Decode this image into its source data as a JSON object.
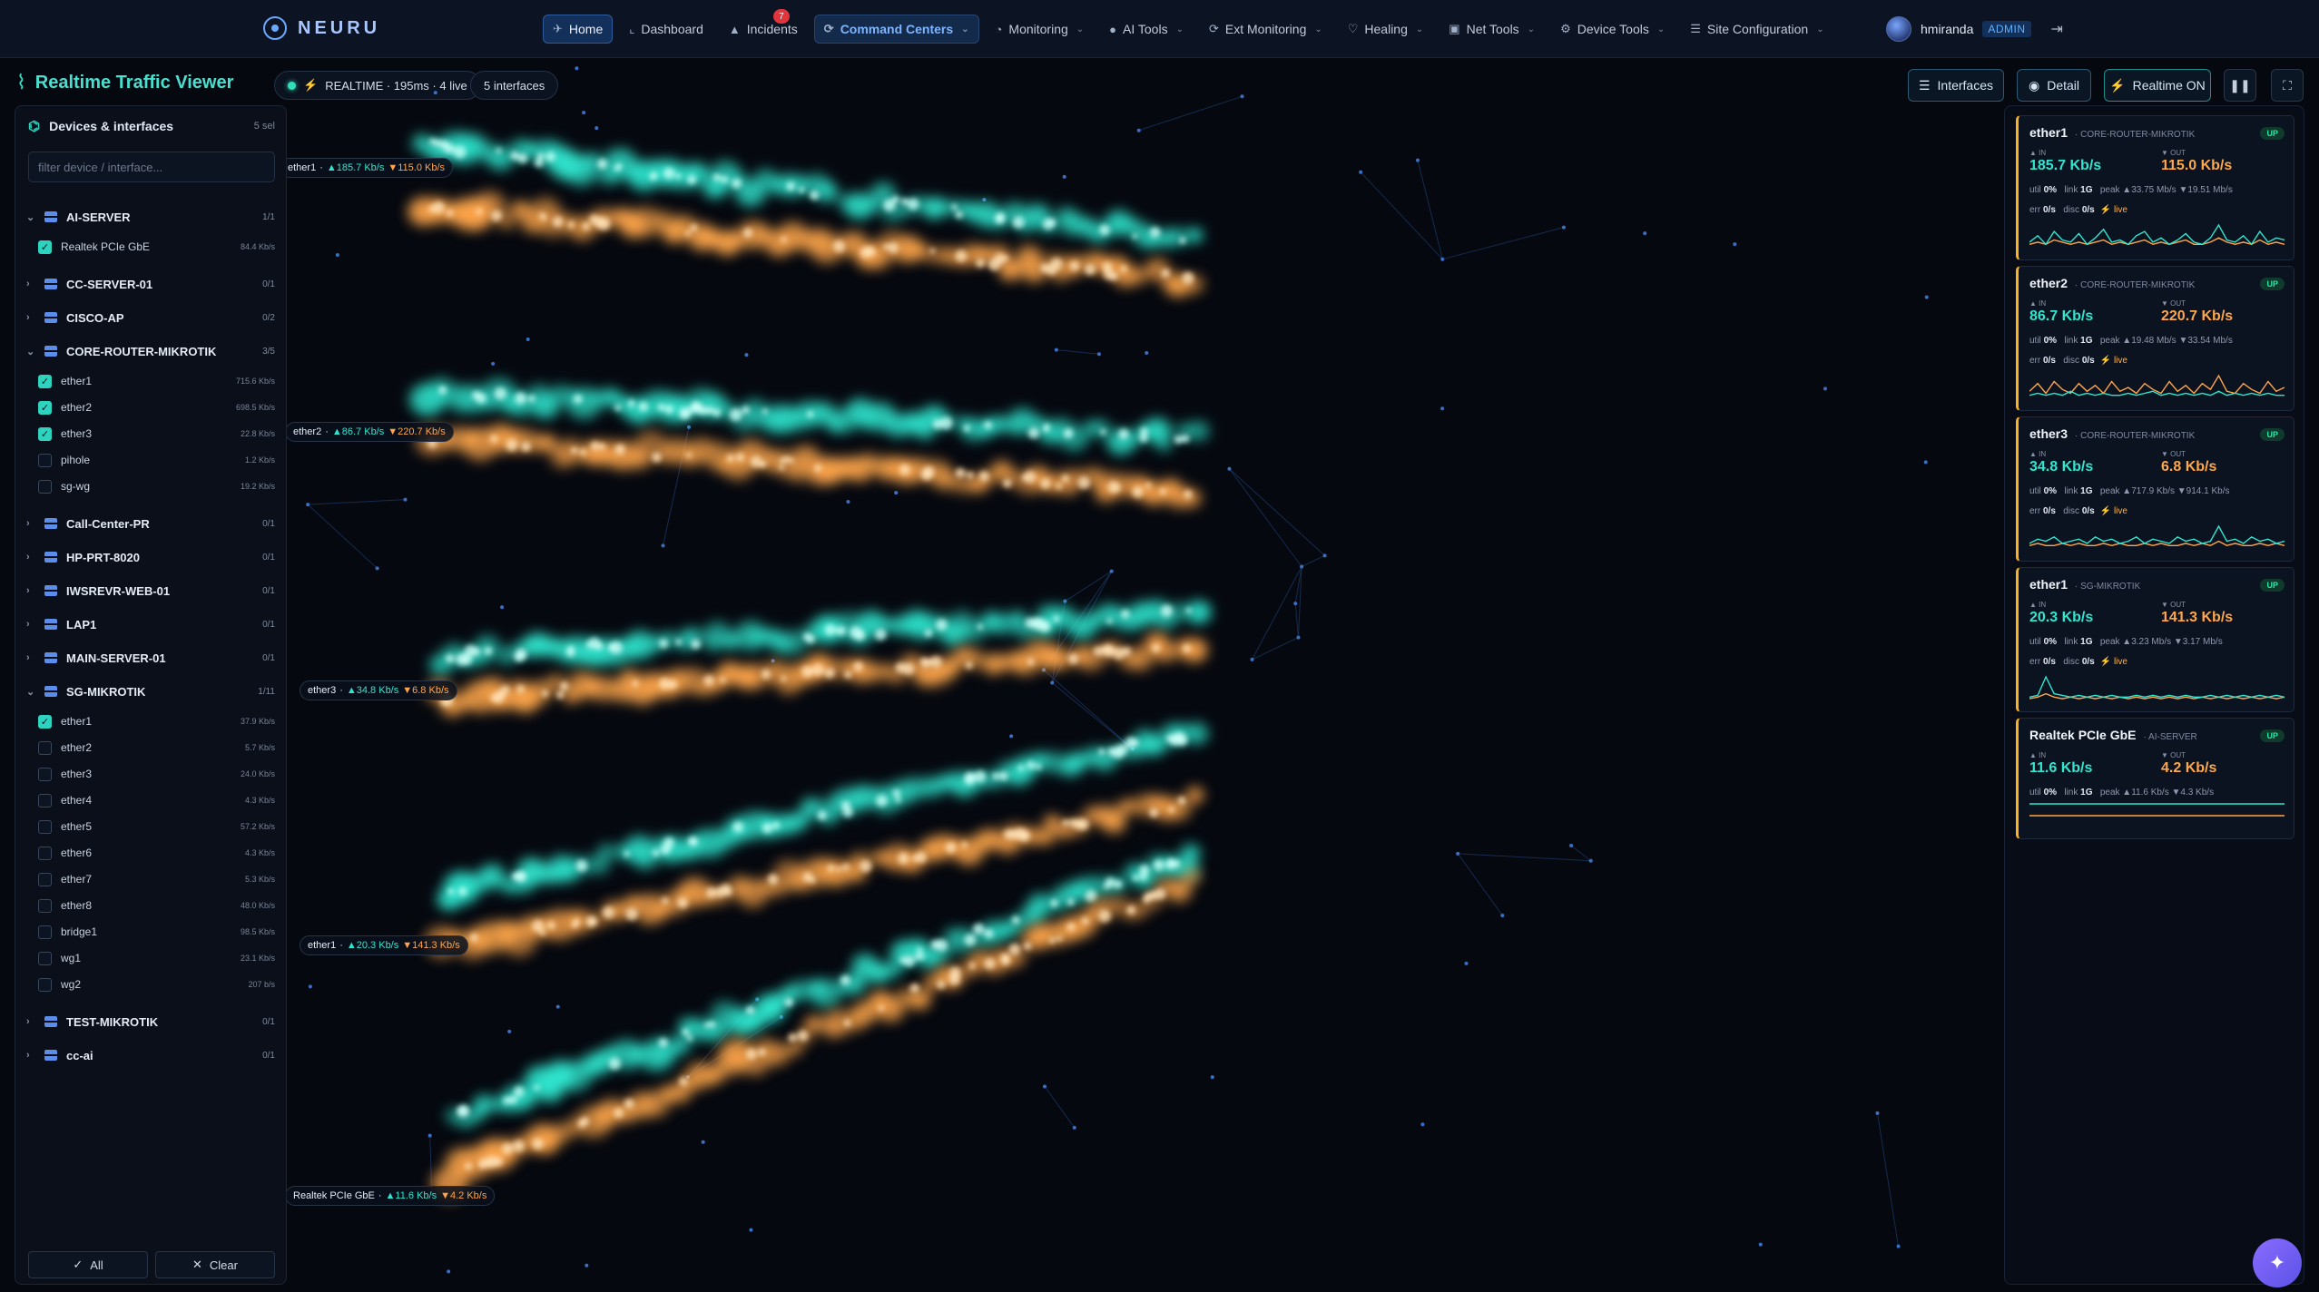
{
  "brand": {
    "name": "NEURU"
  },
  "nav": [
    {
      "label": "Home",
      "icon": "rocket-icon",
      "glyph": "✈",
      "dropdown": false
    },
    {
      "label": "Dashboard",
      "icon": "chart-icon",
      "glyph": "⌞",
      "dropdown": false
    },
    {
      "label": "Incidents",
      "icon": "warning-icon",
      "glyph": "▲",
      "dropdown": false,
      "badge": "7"
    },
    {
      "label": "Command Centers",
      "icon": "satellite-icon",
      "glyph": "⟳",
      "dropdown": true
    },
    {
      "label": "Monitoring",
      "icon": "gauge-icon",
      "glyph": "◔",
      "dropdown": true
    },
    {
      "label": "AI Tools",
      "icon": "robot-icon",
      "glyph": "●",
      "dropdown": true
    },
    {
      "label": "Ext Monitoring",
      "icon": "satellite-dish-icon",
      "glyph": "⟳",
      "dropdown": true
    },
    {
      "label": "Healing",
      "icon": "shield-heart-icon",
      "glyph": "♡",
      "dropdown": true
    },
    {
      "label": "Net Tools",
      "icon": "toolbox-icon",
      "glyph": "▣",
      "dropdown": true
    },
    {
      "label": "Device Tools",
      "icon": "devices-icon",
      "glyph": "⚙",
      "dropdown": true
    },
    {
      "label": "Site Configuration",
      "icon": "list-icon",
      "glyph": "☰",
      "dropdown": true
    }
  ],
  "user": {
    "name": "hmiranda",
    "role": "ADMIN"
  },
  "viewer": {
    "title": "Realtime Traffic Viewer",
    "status": "REALTIME · 195ms · 4 live",
    "interfaces_count": "5 interfaces"
  },
  "toolbar": {
    "interfaces": "Interfaces",
    "detail": "Detail",
    "realtime": "Realtime ON"
  },
  "sidebar": {
    "title": "Devices & interfaces",
    "selected": "5 sel",
    "filter_placeholder": "filter device / interface...",
    "all_label": "All",
    "clear_label": "Clear",
    "devices": [
      {
        "name": "AI-SERVER",
        "count": "1/1",
        "expanded": true,
        "interfaces": [
          {
            "name": "Realtek PCIe GbE",
            "rate": "84.4 Kb/s",
            "checked": true
          }
        ]
      },
      {
        "name": "CC-SERVER-01",
        "count": "0/1",
        "expanded": false,
        "interfaces": []
      },
      {
        "name": "CISCO-AP",
        "count": "0/2",
        "expanded": false,
        "interfaces": []
      },
      {
        "name": "CORE-ROUTER-MIKROTIK",
        "count": "3/5",
        "expanded": true,
        "interfaces": [
          {
            "name": "ether1",
            "rate": "715.6 Kb/s",
            "checked": true
          },
          {
            "name": "ether2",
            "rate": "698.5 Kb/s",
            "checked": true
          },
          {
            "name": "ether3",
            "rate": "22.8 Kb/s",
            "checked": true
          },
          {
            "name": "pihole",
            "rate": "1.2 Kb/s",
            "checked": false
          },
          {
            "name": "sg-wg",
            "rate": "19.2 Kb/s",
            "checked": false
          }
        ]
      },
      {
        "name": "Call-Center-PR",
        "count": "0/1",
        "expanded": false,
        "interfaces": []
      },
      {
        "name": "HP-PRT-8020",
        "count": "0/1",
        "expanded": false,
        "interfaces": []
      },
      {
        "name": "IWSREVR-WEB-01",
        "count": "0/1",
        "expanded": false,
        "interfaces": []
      },
      {
        "name": "LAP1",
        "count": "0/1",
        "expanded": false,
        "interfaces": []
      },
      {
        "name": "MAIN-SERVER-01",
        "count": "0/1",
        "expanded": false,
        "interfaces": []
      },
      {
        "name": "SG-MIKROTIK",
        "count": "1/11",
        "expanded": true,
        "interfaces": [
          {
            "name": "ether1",
            "rate": "37.9 Kb/s",
            "checked": true
          },
          {
            "name": "ether2",
            "rate": "5.7 Kb/s",
            "checked": false
          },
          {
            "name": "ether3",
            "rate": "24.0 Kb/s",
            "checked": false
          },
          {
            "name": "ether4",
            "rate": "4.3 Kb/s",
            "checked": false
          },
          {
            "name": "ether5",
            "rate": "57.2 Kb/s",
            "checked": false
          },
          {
            "name": "ether6",
            "rate": "4.3 Kb/s",
            "checked": false
          },
          {
            "name": "ether7",
            "rate": "5.3 Kb/s",
            "checked": false
          },
          {
            "name": "ether8",
            "rate": "48.0 Kb/s",
            "checked": false
          },
          {
            "name": "bridge1",
            "rate": "98.5 Kb/s",
            "checked": false
          },
          {
            "name": "wg1",
            "rate": "23.1 Kb/s",
            "checked": false
          },
          {
            "name": "wg2",
            "rate": "207 b/s",
            "checked": false
          }
        ]
      },
      {
        "name": "TEST-MIKROTIK",
        "count": "0/1",
        "expanded": false,
        "interfaces": []
      },
      {
        "name": "cc-ai",
        "count": "0/1",
        "expanded": false,
        "interfaces": []
      }
    ]
  },
  "lanes": [
    {
      "name": "ether1",
      "in": "▲185.7 Kb/s",
      "out": "▼115.0 Kb/s"
    },
    {
      "name": "ether2",
      "in": "▲86.7 Kb/s",
      "out": "▼220.7 Kb/s"
    },
    {
      "name": "ether3",
      "in": "▲34.8 Kb/s",
      "out": "▼6.8 Kb/s"
    },
    {
      "name": "ether1",
      "in": "▲20.3 Kb/s",
      "out": "▼141.3 Kb/s"
    },
    {
      "name": "Realtek PCIe GbE",
      "in": "▲11.6 Kb/s",
      "out": "▼4.2 Kb/s"
    }
  ],
  "cards": [
    {
      "name": "ether1",
      "device": "· CORE-ROUTER-MIKROTIK",
      "status": "UP",
      "in_label": "▲ IN",
      "out_label": "▼ OUT",
      "in": "185.7 Kb/s",
      "out": "115.0 Kb/s",
      "util": "0%",
      "link": "1G",
      "peak": "▲33.75 Mb/s ▼19.51 Mb/s",
      "err": "0/s",
      "disc": "0/s",
      "live": "live",
      "spark_in": [
        3,
        6,
        2,
        8,
        4,
        3,
        7,
        2,
        5,
        9,
        3,
        4,
        2,
        6,
        8,
        3,
        5,
        2,
        4,
        7,
        3,
        2,
        5,
        11,
        4,
        3,
        6,
        2,
        8,
        3,
        5,
        4
      ],
      "spark_out": [
        2,
        3,
        2,
        4,
        3,
        2,
        3,
        2,
        3,
        4,
        2,
        3,
        2,
        3,
        4,
        2,
        3,
        2,
        3,
        4,
        2,
        2,
        3,
        5,
        3,
        2,
        3,
        2,
        4,
        2,
        3,
        2
      ]
    },
    {
      "name": "ether2",
      "device": "· CORE-ROUTER-MIKROTIK",
      "status": "UP",
      "in_label": "▲ IN",
      "out_label": "▼ OUT",
      "in": "86.7 Kb/s",
      "out": "220.7 Kb/s",
      "util": "0%",
      "link": "1G",
      "peak": "▲19.48 Mb/s ▼33.54 Mb/s",
      "err": "0/s",
      "disc": "0/s",
      "live": "live",
      "spark_in": [
        2,
        3,
        2,
        3,
        2,
        4,
        2,
        3,
        2,
        3,
        2,
        2,
        3,
        2,
        3,
        4,
        2,
        3,
        2,
        3,
        2,
        3,
        2,
        4,
        2,
        3,
        2,
        3,
        2,
        3,
        2,
        2
      ],
      "spark_out": [
        4,
        8,
        3,
        9,
        5,
        3,
        8,
        4,
        7,
        3,
        9,
        4,
        6,
        3,
        8,
        5,
        3,
        9,
        4,
        7,
        3,
        8,
        5,
        12,
        4,
        3,
        8,
        5,
        3,
        9,
        4,
        6
      ]
    },
    {
      "name": "ether3",
      "device": "· CORE-ROUTER-MIKROTIK",
      "status": "UP",
      "in_label": "▲ IN",
      "out_label": "▼ OUT",
      "in": "34.8 Kb/s",
      "out": "6.8 Kb/s",
      "util": "0%",
      "link": "1G",
      "peak": "▲717.9 Kb/s ▼914.1 Kb/s",
      "err": "0/s",
      "disc": "0/s",
      "live": "live",
      "spark_in": [
        3,
        5,
        4,
        6,
        3,
        4,
        5,
        3,
        6,
        4,
        5,
        3,
        4,
        6,
        3,
        5,
        4,
        3,
        6,
        4,
        5,
        3,
        4,
        11,
        4,
        5,
        3,
        6,
        4,
        5,
        3,
        4
      ],
      "spark_out": [
        2,
        3,
        2,
        2,
        3,
        2,
        3,
        2,
        2,
        3,
        2,
        3,
        2,
        2,
        3,
        2,
        3,
        2,
        2,
        3,
        2,
        3,
        2,
        4,
        2,
        3,
        2,
        2,
        3,
        2,
        3,
        2
      ]
    },
    {
      "name": "ether1",
      "device": "· SG-MIKROTIK",
      "status": "UP",
      "in_label": "▲ IN",
      "out_label": "▼ OUT",
      "in": "20.3 Kb/s",
      "out": "141.3 Kb/s",
      "util": "0%",
      "link": "1G",
      "peak": "▲3.23 Mb/s ▼3.17 Mb/s",
      "err": "0/s",
      "disc": "0/s",
      "live": "live",
      "spark_in": [
        2,
        3,
        14,
        4,
        3,
        2,
        3,
        2,
        3,
        2,
        3,
        2,
        2,
        3,
        2,
        3,
        2,
        3,
        2,
        3,
        2,
        2,
        3,
        2,
        3,
        2,
        3,
        2,
        3,
        2,
        3,
        2
      ],
      "spark_out": [
        1,
        2,
        4,
        2,
        1,
        2,
        1,
        2,
        1,
        2,
        1,
        2,
        1,
        2,
        1,
        2,
        1,
        2,
        1,
        2,
        1,
        2,
        1,
        2,
        1,
        2,
        1,
        2,
        1,
        2,
        1,
        2
      ]
    },
    {
      "name": "Realtek PCIe GbE",
      "device": "· AI-SERVER",
      "status": "UP",
      "in_label": "▲ IN",
      "out_label": "▼ OUT",
      "in": "11.6 Kb/s",
      "out": "4.2 Kb/s",
      "util": "0%",
      "link": "1G",
      "peak": "▲11.6 Kb/s ▼4.3 Kb/s",
      "spark_in": [
        2,
        2,
        2,
        2,
        2,
        2,
        2,
        2,
        2,
        2,
        2,
        2,
        2,
        2,
        2,
        2,
        2,
        2,
        2,
        2,
        2,
        2,
        2,
        2,
        2,
        2,
        2,
        2,
        2,
        2,
        2,
        2
      ],
      "spark_out": [
        1,
        1,
        1,
        1,
        1,
        1,
        1,
        1,
        1,
        1,
        1,
        1,
        1,
        1,
        1,
        1,
        1,
        1,
        1,
        1,
        1,
        1,
        1,
        1,
        1,
        1,
        1,
        1,
        1,
        1,
        1,
        1
      ]
    }
  ],
  "colors": {
    "in": "#2ee6cf",
    "out": "#ffa64a",
    "accent": "#49e0d0"
  }
}
